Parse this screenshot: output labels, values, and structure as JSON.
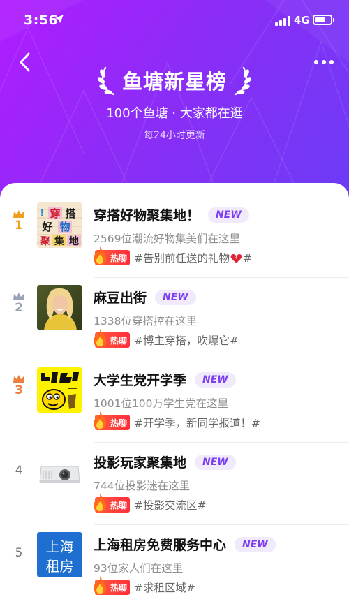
{
  "status_bar": {
    "time": "3:56",
    "network": "4G"
  },
  "header": {
    "title": "鱼塘新星榜",
    "subtitle": "100个鱼塘 · 大家都在逛",
    "update_note": "每24小时更新"
  },
  "colors": {
    "accent": "#7c3ff2",
    "gold": "#f0a01c",
    "silver": "#9aa4b8",
    "bronze": "#ee7f3c",
    "hot": "#ff3b3a"
  },
  "items": [
    {
      "rank": "1",
      "name": "穿搭好物聚集地！",
      "badge": "NEW",
      "desc": "2569位潮流好物集美们在这里",
      "hot_label": "热聊",
      "topic": "#告别前任送的礼物",
      "topic_suffix": "#",
      "thumb_text": [
        "穿",
        "搭",
        "好",
        "物",
        "聚",
        "集",
        "地"
      ]
    },
    {
      "rank": "2",
      "name": "麻豆出街",
      "badge": "NEW",
      "desc": "1338位穿搭控在这里",
      "hot_label": "热聊",
      "topic": "#博主穿搭，吹爆它#"
    },
    {
      "rank": "3",
      "name": "大学生党开学季",
      "badge": "NEW",
      "desc": "1001位100万学生党在这里",
      "hot_label": "热聊",
      "topic": "#开学季，新同学报道！#"
    },
    {
      "rank": "4",
      "name": "投影玩家聚集地",
      "badge": "NEW",
      "desc": "744位投影迷在这里",
      "hot_label": "热聊",
      "topic": "#投影交流区#"
    },
    {
      "rank": "5",
      "name": "上海租房免费服务中心",
      "badge": "NEW",
      "desc": "93位家人们在这里",
      "hot_label": "热聊",
      "topic": "#求租区域#",
      "thumb_text": [
        "上海",
        "租房"
      ]
    }
  ]
}
